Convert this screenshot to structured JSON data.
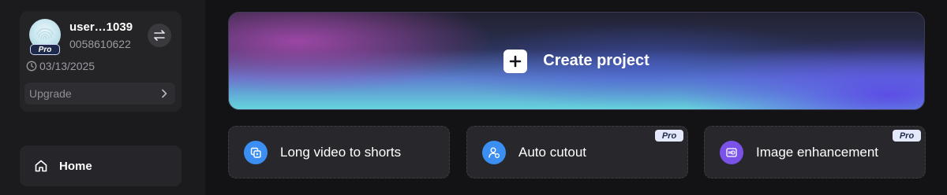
{
  "user": {
    "name": "user…1039",
    "id": "0058610622",
    "plan_badge": "Pro",
    "expiry_date": "03/13/2025",
    "upgrade_label": "Upgrade"
  },
  "sidebar": {
    "items": [
      {
        "label": "Home",
        "icon": "home-icon"
      }
    ]
  },
  "main": {
    "create_project_label": "Create project",
    "tools": [
      {
        "label": "Long video to shorts",
        "icon": "video-shorts-icon",
        "icon_color": "#3b8ef2",
        "pro": ""
      },
      {
        "label": "Auto cutout",
        "icon": "person-cutout-icon",
        "icon_color": "#3b8ef2",
        "pro": "Pro"
      },
      {
        "label": "Image enhancement",
        "icon": "hd-icon",
        "icon_color": "#7a52e8",
        "pro": "Pro"
      }
    ]
  },
  "colors": {
    "background": "#121214",
    "sidebar": "#1b1b1d",
    "card": "#28282c",
    "blue_icon": "#3b8ef2",
    "purple_icon": "#7a52e8"
  }
}
